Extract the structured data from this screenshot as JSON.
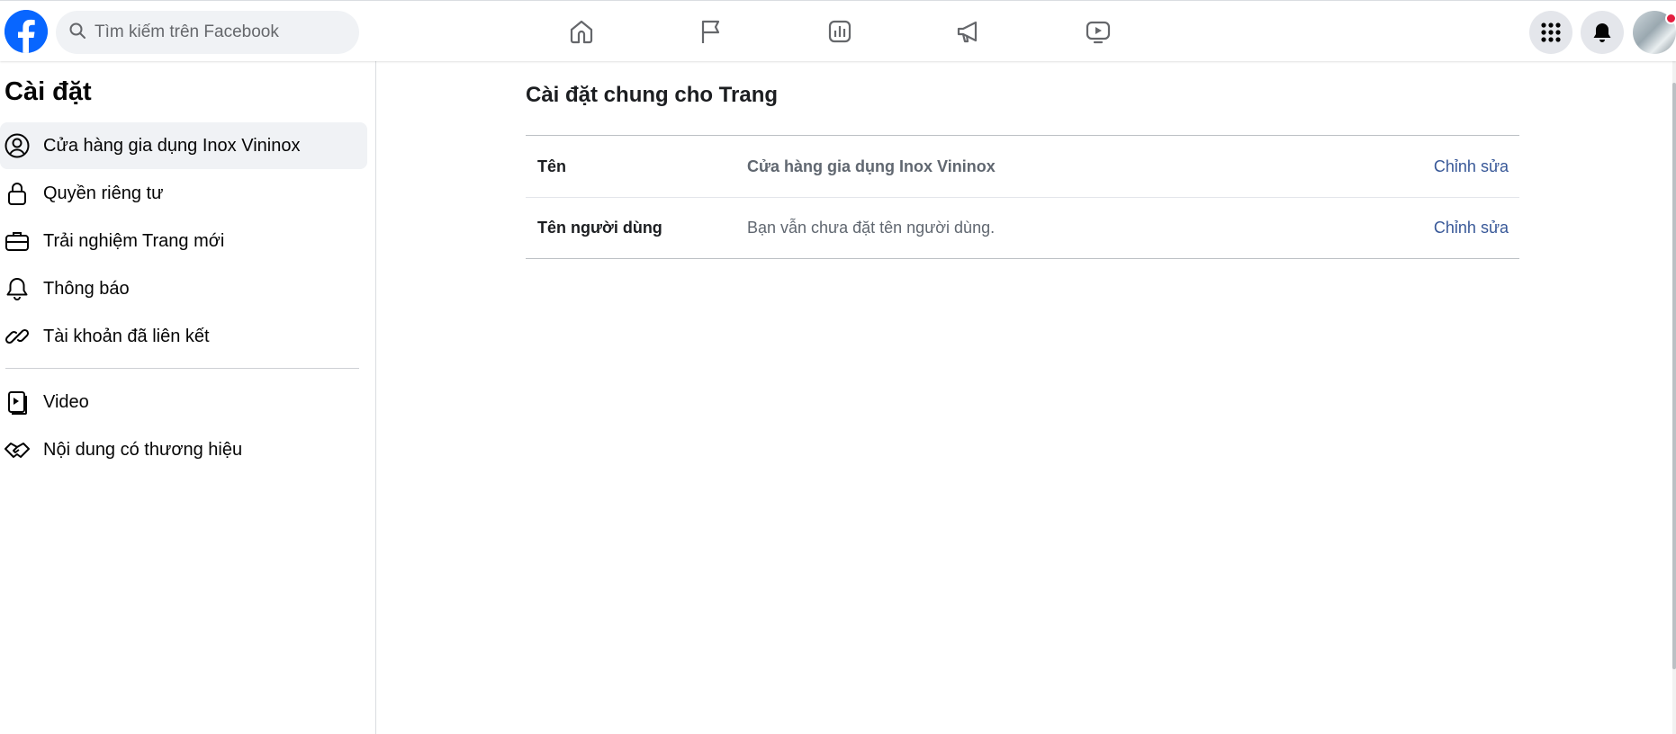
{
  "colors": {
    "brand": "#0866ff",
    "link": "#385898",
    "badge": "#e41e3f",
    "hover_bg": "#f0f2f5"
  },
  "topbar": {
    "logo_icon": "facebook-logo",
    "search": {
      "icon": "search-icon",
      "placeholder": "Tìm kiếm trên Facebook",
      "value": ""
    },
    "nav_icons": [
      "home-icon",
      "flag-icon",
      "insights-icon",
      "megaphone-icon",
      "video-play-icon"
    ],
    "right": {
      "menu_icon": "grid-menu-icon",
      "notifications_icon": "bell-icon",
      "avatar_has_badge": true
    }
  },
  "sidebar": {
    "title": "Cài đặt",
    "items": [
      {
        "label": "Cửa hàng gia dụng Inox Vininox",
        "icon": "user-circle-icon",
        "active": true
      },
      {
        "label": "Quyền riêng tư",
        "icon": "lock-icon",
        "active": false
      },
      {
        "label": "Trải nghiệm Trang mới",
        "icon": "briefcase-icon",
        "active": false
      },
      {
        "label": "Thông báo",
        "icon": "bell-icon",
        "active": false
      },
      {
        "label": "Tài khoản đã liên kết",
        "icon": "link-icon",
        "active": false
      },
      {
        "label": "Video",
        "icon": "video-file-icon",
        "active": false
      },
      {
        "label": "Nội dung có thương hiệu",
        "icon": "handshake-icon",
        "active": false
      }
    ]
  },
  "main": {
    "title": "Cài đặt chung cho Trang",
    "rows": [
      {
        "key": "Tên",
        "value": "Cửa hàng gia dụng Inox Vininox",
        "action": "Chỉnh sửa"
      },
      {
        "key": "Tên người dùng",
        "value": "Bạn vẫn chưa đặt tên người dùng.",
        "action": "Chỉnh sửa"
      }
    ]
  }
}
